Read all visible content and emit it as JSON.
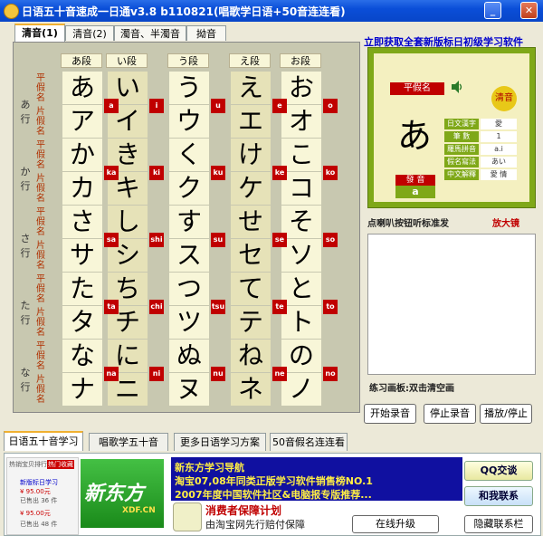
{
  "window": {
    "title": "日语五十音速成一日通v3.8 b110821(唱歌学日语+50音连连看)"
  },
  "top_tabs": [
    "清音(1)",
    "清音(2)",
    "濁音、半濁音",
    "拗音"
  ],
  "grid": {
    "columns": [
      "あ段",
      "い段",
      "う段",
      "え段",
      "お段"
    ],
    "kind_labels": {
      "hiragana": "平假名",
      "katakana": "片假名"
    },
    "rows": [
      {
        "label": "あ行",
        "hiragana": [
          "あ",
          "い",
          "う",
          "え",
          "お"
        ],
        "katakana": [
          "ア",
          "イ",
          "ウ",
          "エ",
          "オ"
        ],
        "romaji": [
          "a",
          "i",
          "u",
          "e",
          "o"
        ]
      },
      {
        "label": "か行",
        "hiragana": [
          "か",
          "き",
          "く",
          "け",
          "こ"
        ],
        "katakana": [
          "カ",
          "キ",
          "ク",
          "ケ",
          "コ"
        ],
        "romaji": [
          "ka",
          "ki",
          "ku",
          "ke",
          "ko"
        ]
      },
      {
        "label": "さ行",
        "hiragana": [
          "さ",
          "し",
          "す",
          "せ",
          "そ"
        ],
        "katakana": [
          "サ",
          "シ",
          "ス",
          "セ",
          "ソ"
        ],
        "romaji": [
          "sa",
          "shi",
          "su",
          "se",
          "so"
        ]
      },
      {
        "label": "た行",
        "hiragana": [
          "た",
          "ち",
          "つ",
          "て",
          "と"
        ],
        "katakana": [
          "タ",
          "チ",
          "ツ",
          "テ",
          "ト"
        ],
        "romaji": [
          "ta",
          "chi",
          "tsu",
          "te",
          "to"
        ]
      },
      {
        "label": "な行",
        "hiragana": [
          "な",
          "に",
          "ぬ",
          "ね",
          "の"
        ],
        "katakana": [
          "ナ",
          "ニ",
          "ヌ",
          "ネ",
          "ノ"
        ],
        "romaji": [
          "na",
          "ni",
          "nu",
          "ne",
          "no"
        ]
      }
    ]
  },
  "right": {
    "link": "立即获取全套新版标日初级学习软件",
    "info": {
      "kind": "平假名",
      "sound_type": "清音",
      "kana": "あ",
      "pronounce_label": "發 音",
      "pronounce_value": "a",
      "rows": [
        {
          "k": "日文漢字",
          "v": "愛"
        },
        {
          "k": "筆 數",
          "v": "1"
        },
        {
          "k": "羅馬拼音",
          "v": "a.i"
        },
        {
          "k": "假名寫法",
          "v": "あい"
        },
        {
          "k": "中文解釋",
          "v": "愛 情"
        }
      ]
    },
    "hint": "点喇叭按钮听标准发",
    "zoom": "放大镜",
    "canvas_label": "练习画板:双击清空画",
    "buttons": {
      "record": "开始录音",
      "stop": "停止录音",
      "play": "播放/停止"
    }
  },
  "bottom_tabs": [
    "日语五十音学习",
    "唱歌学五十音",
    "更多日语学习方案",
    "50音假名连连看"
  ],
  "bottom": {
    "thumb_lines": [
      "热销宝贝排行",
      "热门收藏",
      "新版标日学习",
      "¥ 95.00元",
      "已售出 36 件",
      "¥ 95.00元",
      "已售出 48 件"
    ],
    "logo_main": "新东方",
    "logo_sub": "XDF.CN",
    "promo": [
      "新东方学习导航",
      "淘宝07,08年同类正版学习软件销售榜NO.1",
      "2007年度中国软件社区&电脑报专版推荐..."
    ],
    "consumer_title": "消费者保障计划",
    "consumer_sub": "由淘宝网先行赔付保障",
    "qq": "QQ交谈",
    "contact": "和我联系",
    "upgrade": "在线升级",
    "hide": "隐藏联系栏"
  }
}
